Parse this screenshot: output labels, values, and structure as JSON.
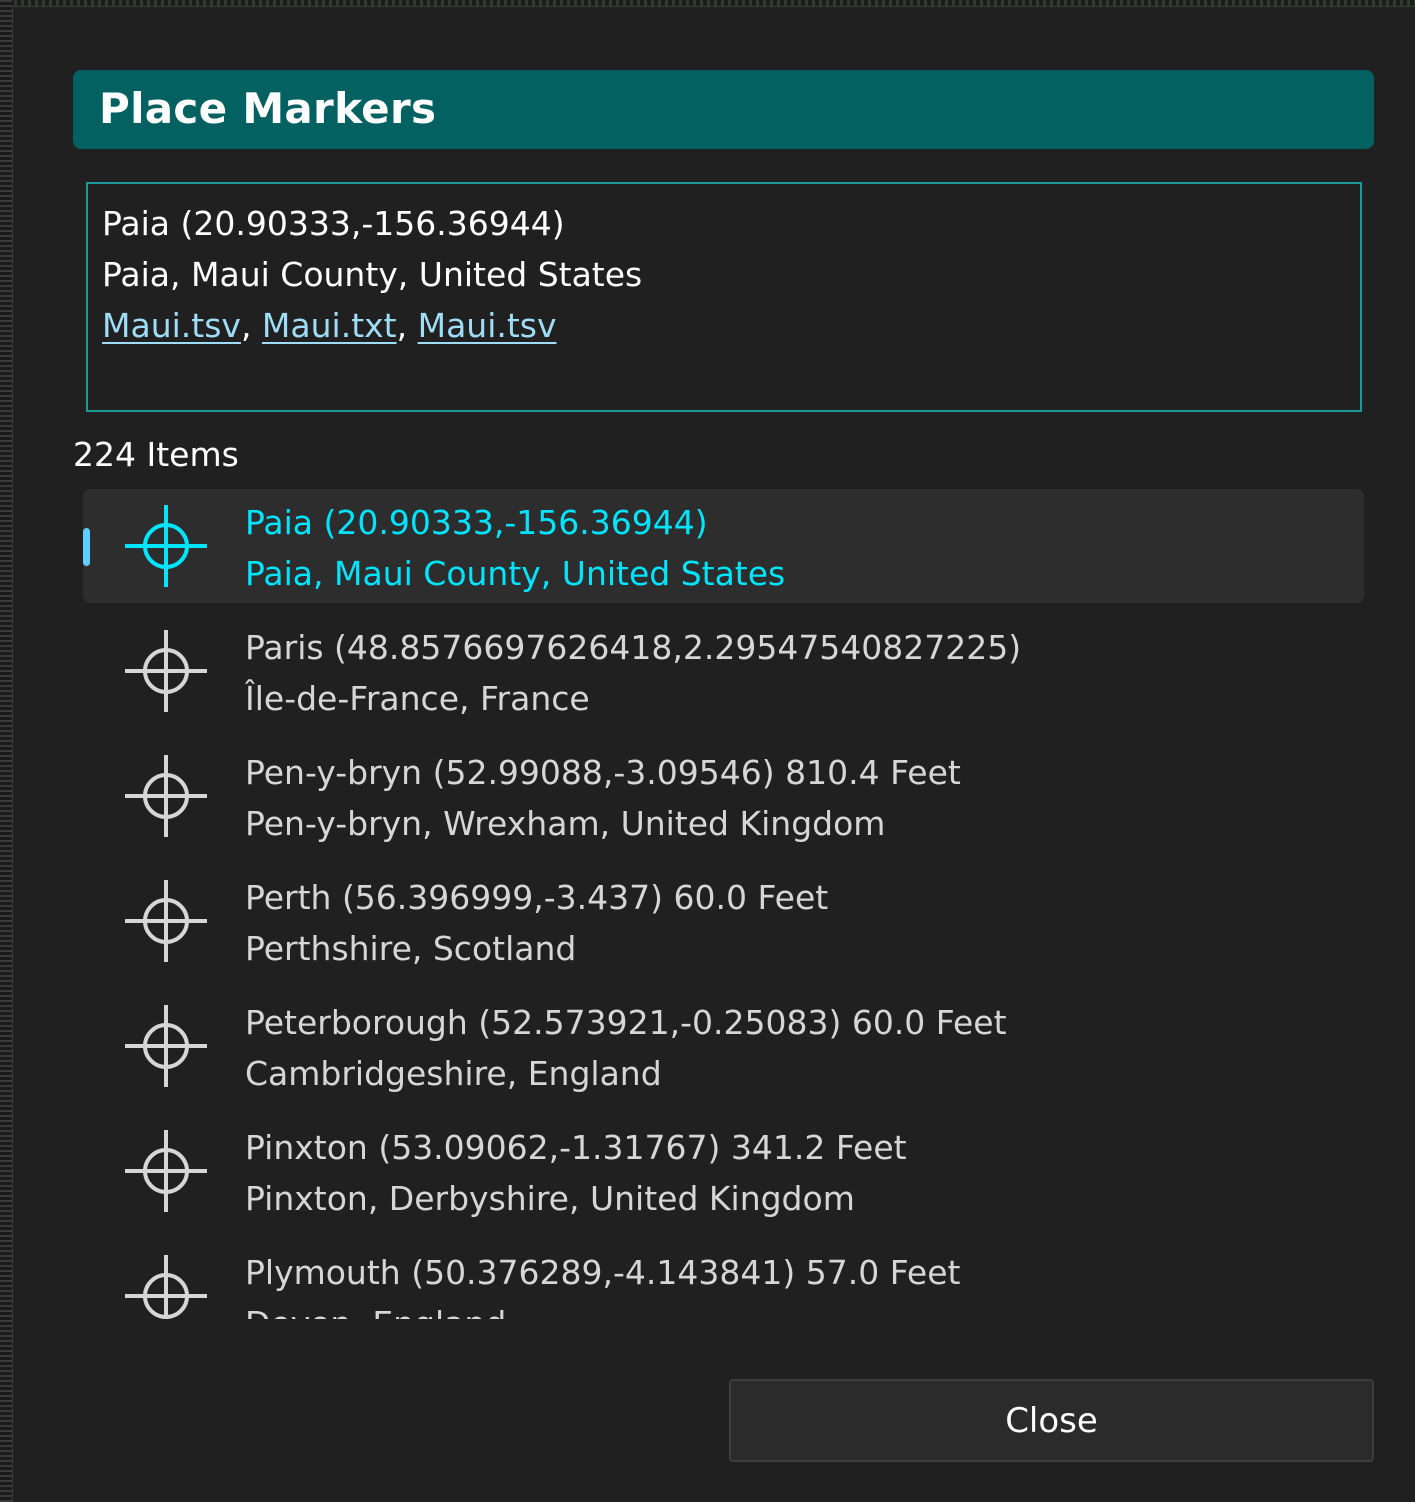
{
  "dialog": {
    "title": "Place Markers"
  },
  "details": {
    "line1": "Paia (20.90333,-156.36944)",
    "line2": "Paia, Maui County, United States",
    "files": [
      "Maui.tsv",
      "Maui.txt",
      "Maui.tsv"
    ],
    "separator": ", "
  },
  "list": {
    "count_label": "224 Items",
    "items": [
      {
        "line1": "Paia (20.90333,-156.36944)",
        "line2": "Paia, Maui County, United States",
        "selected": true
      },
      {
        "line1": "Paris (48.8576697626418,2.29547540827225)",
        "line2": "Île-de-France, France",
        "selected": false
      },
      {
        "line1": "Pen-y-bryn (52.99088,-3.09546) 810.4 Feet",
        "line2": "Pen-y-bryn, Wrexham, United Kingdom",
        "selected": false
      },
      {
        "line1": "Perth (56.396999,-3.437) 60.0 Feet",
        "line2": "Perthshire, Scotland",
        "selected": false
      },
      {
        "line1": "Peterborough (52.573921,-0.25083) 60.0 Feet",
        "line2": "Cambridgeshire, England",
        "selected": false
      },
      {
        "line1": "Pinxton (53.09062,-1.31767) 341.2 Feet",
        "line2": "Pinxton, Derbyshire, United Kingdom",
        "selected": false
      },
      {
        "line1": "Plymouth (50.376289,-4.143841) 57.0 Feet",
        "line2": "Devon, England",
        "selected": false
      }
    ],
    "icon": "crosshair-icon"
  },
  "buttons": {
    "close_label": "Close"
  },
  "colors": {
    "accent_title": "#046161",
    "detail_border": "#1a9a98",
    "selected_text": "#00e5ff",
    "selection_indicator": "#60cdff",
    "link": "#9fdcf5"
  }
}
